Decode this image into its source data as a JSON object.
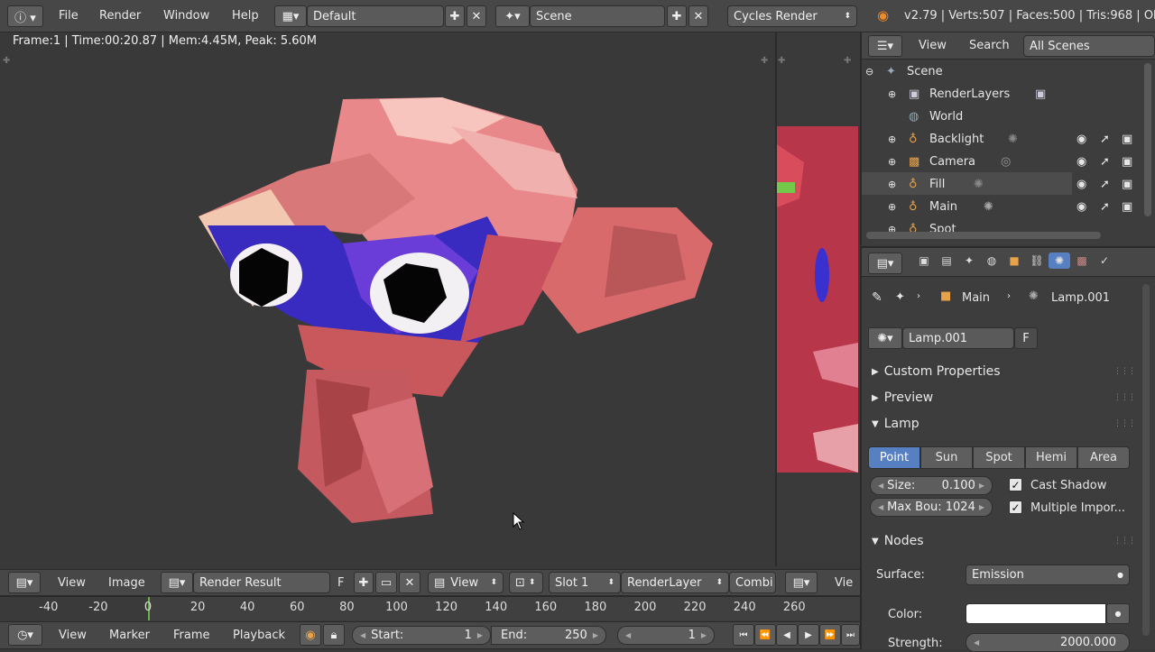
{
  "top_bar": {
    "menus": [
      "File",
      "Render",
      "Window",
      "Help"
    ],
    "screen_layout": "Default",
    "scene_name": "Scene",
    "engine": "Cycles Render",
    "stats": "v2.79 | Verts:507 | Faces:500 | Tris:968 | Ob"
  },
  "image_editor": {
    "info_line": "Frame:1 | Time:00:20.87 | Mem:4.45M, Peak: 5.60M",
    "header": {
      "view": "View",
      "image": "Image",
      "image_name": "Render Result",
      "f_label": "F",
      "view_dropdown": "View",
      "slot": "Slot 1",
      "layer": "RenderLayer",
      "pass": "Combi"
    },
    "second_editor_view": "Vie"
  },
  "outliner": {
    "header": {
      "view": "View",
      "search": "Search",
      "filter": "All Scenes"
    },
    "items": [
      {
        "label": "Scene"
      },
      {
        "label": "RenderLayers"
      },
      {
        "label": "World"
      },
      {
        "label": "Backlight"
      },
      {
        "label": "Camera"
      },
      {
        "label": "Fill"
      },
      {
        "label": "Main"
      },
      {
        "label": "Spot"
      }
    ]
  },
  "properties": {
    "breadcrumb": {
      "object": "Main",
      "lamp": "Lamp.001"
    },
    "datablock": {
      "name": "Lamp.001",
      "fake_user": "F"
    },
    "panels": {
      "custom_props": "Custom Properties",
      "preview": "Preview",
      "lamp": "Lamp",
      "nodes": "Nodes"
    },
    "lamp_types": [
      "Point",
      "Sun",
      "Spot",
      "Hemi",
      "Area"
    ],
    "active_lamp_type": "Point",
    "size": {
      "label": "Size:",
      "value": "0.100"
    },
    "max_bounces": {
      "label": "Max Bou:",
      "value": "1024"
    },
    "cast_shadow": "Cast Shadow",
    "multiple_importance": "Multiple Impor...",
    "surface": {
      "label": "Surface:",
      "value": "Emission"
    },
    "color": {
      "label": "Color:"
    },
    "strength": {
      "label": "Strength:",
      "value": "2000.000"
    }
  },
  "timeline": {
    "ticks": [
      "-40",
      "-20",
      "0",
      "20",
      "40",
      "60",
      "80",
      "100",
      "120",
      "140",
      "160",
      "180",
      "200",
      "220",
      "240",
      "260"
    ],
    "menus": [
      "View",
      "Marker",
      "Frame",
      "Playback"
    ],
    "start": {
      "label": "Start:",
      "value": "1"
    },
    "end": {
      "label": "End:",
      "value": "250"
    },
    "current": "1"
  },
  "colors": {
    "accent": "#5680c2",
    "header": "#474747",
    "panel": "#3d3d3d",
    "viewport": "#393939"
  }
}
